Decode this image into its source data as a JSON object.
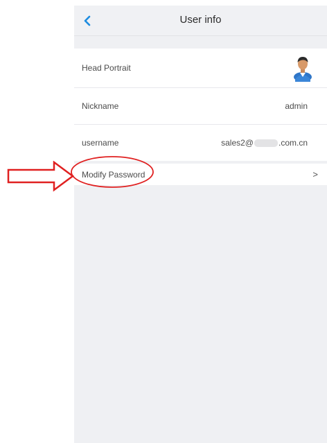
{
  "header": {
    "title": "User info",
    "back_icon": "chevron-left-icon",
    "accent": "#1d8ce0"
  },
  "rows": {
    "head_portrait": {
      "label": "Head Portrait",
      "icon": "user-avatar-icon"
    },
    "nickname": {
      "label": "Nickname",
      "value": "admin"
    },
    "username": {
      "label": "username",
      "value_prefix": "sales2@",
      "value_suffix": ".com.cn"
    },
    "modify_password": {
      "label": "Modify Password",
      "chevron": ">"
    }
  },
  "annotation": {
    "color": "#e02020",
    "arrow_icon": "right-arrow-outline-icon",
    "highlight_icon": "ellipse-highlight-icon"
  }
}
